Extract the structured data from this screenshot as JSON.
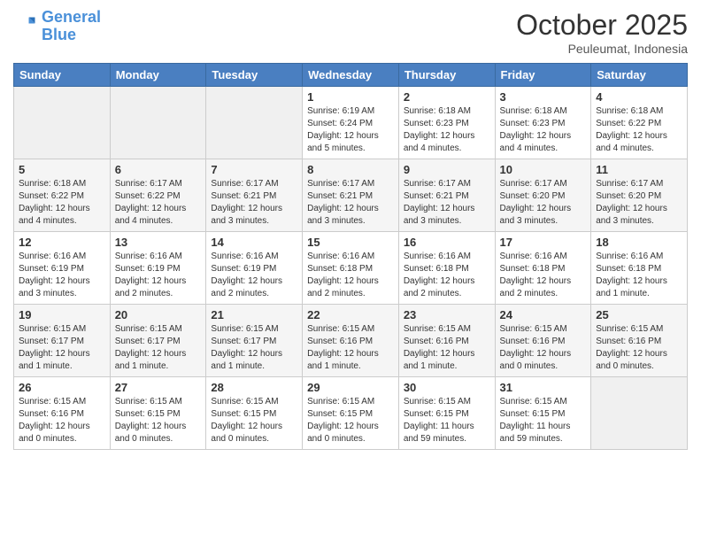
{
  "header": {
    "logo_line1": "General",
    "logo_line2": "Blue",
    "month": "October 2025",
    "location": "Peuleumat, Indonesia"
  },
  "weekdays": [
    "Sunday",
    "Monday",
    "Tuesday",
    "Wednesday",
    "Thursday",
    "Friday",
    "Saturday"
  ],
  "weeks": [
    [
      {
        "day": "",
        "info": ""
      },
      {
        "day": "",
        "info": ""
      },
      {
        "day": "",
        "info": ""
      },
      {
        "day": "1",
        "info": "Sunrise: 6:19 AM\nSunset: 6:24 PM\nDaylight: 12 hours\nand 5 minutes."
      },
      {
        "day": "2",
        "info": "Sunrise: 6:18 AM\nSunset: 6:23 PM\nDaylight: 12 hours\nand 4 minutes."
      },
      {
        "day": "3",
        "info": "Sunrise: 6:18 AM\nSunset: 6:23 PM\nDaylight: 12 hours\nand 4 minutes."
      },
      {
        "day": "4",
        "info": "Sunrise: 6:18 AM\nSunset: 6:22 PM\nDaylight: 12 hours\nand 4 minutes."
      }
    ],
    [
      {
        "day": "5",
        "info": "Sunrise: 6:18 AM\nSunset: 6:22 PM\nDaylight: 12 hours\nand 4 minutes."
      },
      {
        "day": "6",
        "info": "Sunrise: 6:17 AM\nSunset: 6:22 PM\nDaylight: 12 hours\nand 4 minutes."
      },
      {
        "day": "7",
        "info": "Sunrise: 6:17 AM\nSunset: 6:21 PM\nDaylight: 12 hours\nand 3 minutes."
      },
      {
        "day": "8",
        "info": "Sunrise: 6:17 AM\nSunset: 6:21 PM\nDaylight: 12 hours\nand 3 minutes."
      },
      {
        "day": "9",
        "info": "Sunrise: 6:17 AM\nSunset: 6:21 PM\nDaylight: 12 hours\nand 3 minutes."
      },
      {
        "day": "10",
        "info": "Sunrise: 6:17 AM\nSunset: 6:20 PM\nDaylight: 12 hours\nand 3 minutes."
      },
      {
        "day": "11",
        "info": "Sunrise: 6:17 AM\nSunset: 6:20 PM\nDaylight: 12 hours\nand 3 minutes."
      }
    ],
    [
      {
        "day": "12",
        "info": "Sunrise: 6:16 AM\nSunset: 6:19 PM\nDaylight: 12 hours\nand 3 minutes."
      },
      {
        "day": "13",
        "info": "Sunrise: 6:16 AM\nSunset: 6:19 PM\nDaylight: 12 hours\nand 2 minutes."
      },
      {
        "day": "14",
        "info": "Sunrise: 6:16 AM\nSunset: 6:19 PM\nDaylight: 12 hours\nand 2 minutes."
      },
      {
        "day": "15",
        "info": "Sunrise: 6:16 AM\nSunset: 6:18 PM\nDaylight: 12 hours\nand 2 minutes."
      },
      {
        "day": "16",
        "info": "Sunrise: 6:16 AM\nSunset: 6:18 PM\nDaylight: 12 hours\nand 2 minutes."
      },
      {
        "day": "17",
        "info": "Sunrise: 6:16 AM\nSunset: 6:18 PM\nDaylight: 12 hours\nand 2 minutes."
      },
      {
        "day": "18",
        "info": "Sunrise: 6:16 AM\nSunset: 6:18 PM\nDaylight: 12 hours\nand 1 minute."
      }
    ],
    [
      {
        "day": "19",
        "info": "Sunrise: 6:15 AM\nSunset: 6:17 PM\nDaylight: 12 hours\nand 1 minute."
      },
      {
        "day": "20",
        "info": "Sunrise: 6:15 AM\nSunset: 6:17 PM\nDaylight: 12 hours\nand 1 minute."
      },
      {
        "day": "21",
        "info": "Sunrise: 6:15 AM\nSunset: 6:17 PM\nDaylight: 12 hours\nand 1 minute."
      },
      {
        "day": "22",
        "info": "Sunrise: 6:15 AM\nSunset: 6:16 PM\nDaylight: 12 hours\nand 1 minute."
      },
      {
        "day": "23",
        "info": "Sunrise: 6:15 AM\nSunset: 6:16 PM\nDaylight: 12 hours\nand 1 minute."
      },
      {
        "day": "24",
        "info": "Sunrise: 6:15 AM\nSunset: 6:16 PM\nDaylight: 12 hours\nand 0 minutes."
      },
      {
        "day": "25",
        "info": "Sunrise: 6:15 AM\nSunset: 6:16 PM\nDaylight: 12 hours\nand 0 minutes."
      }
    ],
    [
      {
        "day": "26",
        "info": "Sunrise: 6:15 AM\nSunset: 6:16 PM\nDaylight: 12 hours\nand 0 minutes."
      },
      {
        "day": "27",
        "info": "Sunrise: 6:15 AM\nSunset: 6:15 PM\nDaylight: 12 hours\nand 0 minutes."
      },
      {
        "day": "28",
        "info": "Sunrise: 6:15 AM\nSunset: 6:15 PM\nDaylight: 12 hours\nand 0 minutes."
      },
      {
        "day": "29",
        "info": "Sunrise: 6:15 AM\nSunset: 6:15 PM\nDaylight: 12 hours\nand 0 minutes."
      },
      {
        "day": "30",
        "info": "Sunrise: 6:15 AM\nSunset: 6:15 PM\nDaylight: 11 hours\nand 59 minutes."
      },
      {
        "day": "31",
        "info": "Sunrise: 6:15 AM\nSunset: 6:15 PM\nDaylight: 11 hours\nand 59 minutes."
      },
      {
        "day": "",
        "info": ""
      }
    ]
  ]
}
